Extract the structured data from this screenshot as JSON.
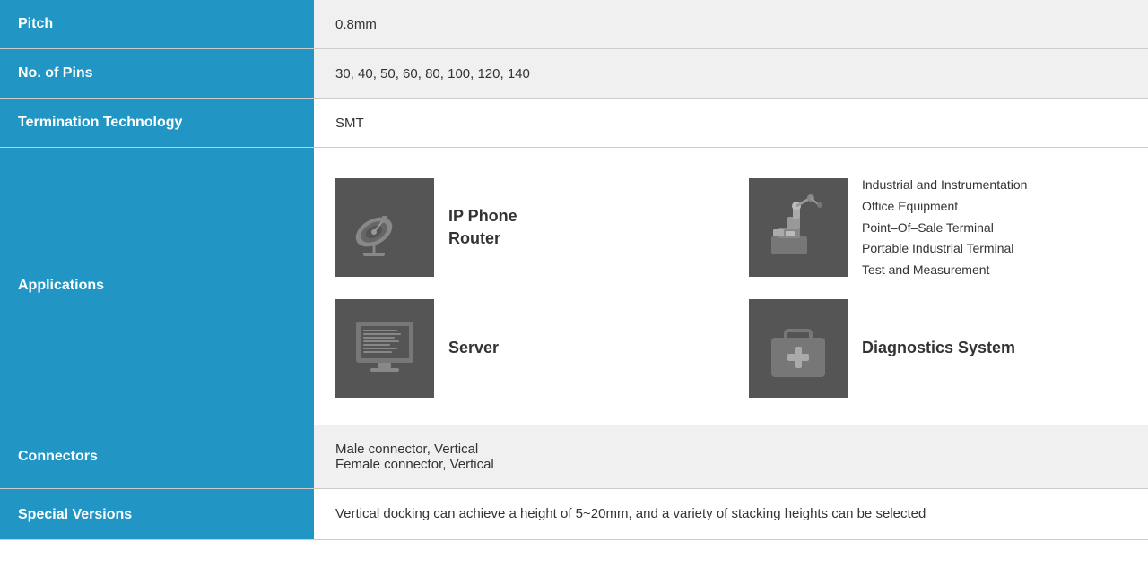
{
  "rows": {
    "pitch": {
      "label": "Pitch",
      "value": "0.8mm"
    },
    "no_of_pins": {
      "label": "No. of Pins",
      "value": "30, 40, 50, 60, 80, 100, 120, 140"
    },
    "termination_technology": {
      "label": "Termination Technology",
      "value": "SMT"
    },
    "applications": {
      "label": "Applications",
      "items": [
        {
          "icon": "satellite",
          "label": "IP Phone\nRouter"
        },
        {
          "icon": "industrial",
          "label_lines": [
            "Industrial and Instrumentation",
            "Office Equipment",
            "Point–Of–Sale Terminal",
            "Portable Industrial Terminal",
            "Test and Measurement"
          ]
        },
        {
          "icon": "server",
          "label": "Server"
        },
        {
          "icon": "diagnostics",
          "label": "Diagnostics System"
        }
      ]
    },
    "connectors": {
      "label": "Connectors",
      "value": "Male connector, Vertical\nFemale connector, Vertical"
    },
    "special_versions": {
      "label": "Special Versions",
      "value": "Vertical docking can achieve a height of 5~20mm, and a variety of stacking heights can be selected"
    }
  }
}
